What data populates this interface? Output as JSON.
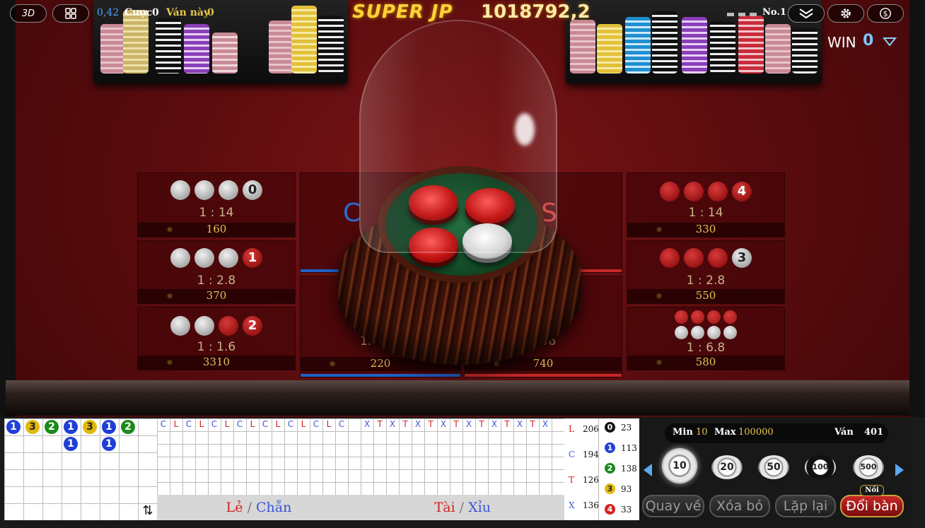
{
  "topbar": {
    "mode": "3D",
    "balance": "0,42",
    "bet_label": "Cược",
    "bet_value": "0",
    "round_label": "Ván này",
    "round_value": "0",
    "jackpot_label": "SUPER JP",
    "jackpot_value": "1018792,2",
    "rank": "No.1",
    "win_label": "WIN",
    "win_value": "0"
  },
  "board": {
    "left": [
      {
        "badge": "0",
        "odds": "1 : 14",
        "amount": "160"
      },
      {
        "badge": "1",
        "odds": "1 : 2.8",
        "amount": "370"
      },
      {
        "badge": "2",
        "odds": "1 : 1.6",
        "amount": "3310"
      }
    ],
    "right": [
      {
        "badge": "4",
        "odds": "1 : 14",
        "amount": "330"
      },
      {
        "badge": "3",
        "odds": "1 : 2.8",
        "amount": "550"
      },
      {
        "badge": "",
        "odds": "1 : 6.8",
        "amount": "580"
      }
    ],
    "center": {
      "left_amount": "220",
      "right_amount": "740",
      "left_odds_partial": "1.",
      "right_odds_partial": ".96",
      "left_label_partial": "C",
      "right_label_partial": "S"
    }
  },
  "history_balls": {
    "row1": [
      "1",
      "3",
      "2",
      "1",
      "3",
      "1",
      "2"
    ],
    "row2": [
      "",
      "",
      "",
      "1",
      "",
      "1",
      ""
    ]
  },
  "le_chan": {
    "row1": [
      "C",
      "L",
      "C",
      "L",
      "C",
      "L",
      "C",
      "L",
      "C",
      "L",
      "C",
      "L",
      "C",
      "L",
      "C"
    ],
    "tab_left": "Lẻ",
    "tab_sep": "/",
    "tab_right": "Chẵn"
  },
  "tai_xiu": {
    "row1": [
      "X",
      "T",
      "X",
      "T",
      "X",
      "T",
      "X",
      "T",
      "X",
      "T",
      "X",
      "T",
      "X",
      "T",
      "X"
    ],
    "tab_left": "Tài",
    "tab_sep": "/",
    "tab_right": "Xỉu"
  },
  "stats": {
    "letters": [
      {
        "label": "L",
        "value": "206"
      },
      {
        "label": "C",
        "value": "194"
      },
      {
        "label": "T",
        "value": "126"
      },
      {
        "label": "X",
        "value": "136"
      }
    ],
    "numbers": [
      {
        "label": "0",
        "value": "23"
      },
      {
        "label": "1",
        "value": "113"
      },
      {
        "label": "2",
        "value": "138"
      },
      {
        "label": "3",
        "value": "93"
      },
      {
        "label": "4",
        "value": "33"
      }
    ]
  },
  "controls": {
    "min_label": "Min",
    "min_value": "10",
    "max_label": "Max",
    "max_value": "100000",
    "round_label": "Ván",
    "round_value": "401",
    "chips": [
      "10",
      "20",
      "50",
      "100",
      "500"
    ],
    "buttons": {
      "back": "Quay về",
      "clear": "Xóa bỏ",
      "repeat": "Lặp lại",
      "switch": "Đổi bàn",
      "switch_badge": "Nồi"
    }
  },
  "colors": {
    "ball_0": "#ffffff",
    "ball_1": "#1f3fd6",
    "ball_2": "#1b8a1b",
    "ball_3": "#e2b90a",
    "ball_4": "#d62020",
    "le": "#d62020",
    "chan": "#3a54d6"
  }
}
